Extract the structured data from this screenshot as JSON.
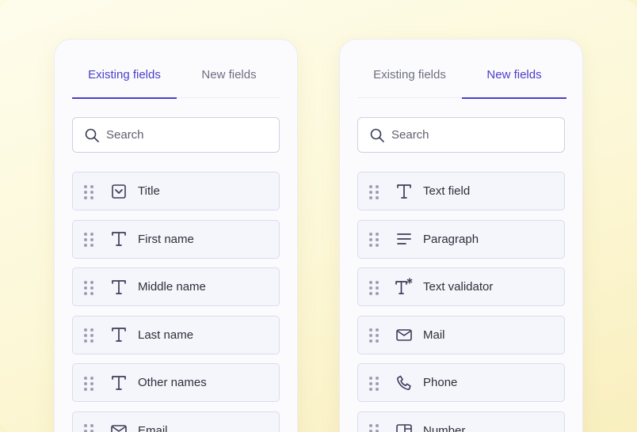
{
  "colors": {
    "accent": "#4a3fc8",
    "icon": "#3c3c58",
    "grip": "#9d9db0"
  },
  "left_panel": {
    "tabs": [
      {
        "label": "Existing fields",
        "active": true
      },
      {
        "label": "New fields",
        "active": false
      }
    ],
    "search": {
      "placeholder": "Search",
      "icon": "search-icon"
    },
    "fields": [
      {
        "label": "Title",
        "icon": "dropdown-icon"
      },
      {
        "label": "First name",
        "icon": "text-icon"
      },
      {
        "label": "Middle name",
        "icon": "text-icon"
      },
      {
        "label": "Last name",
        "icon": "text-icon"
      },
      {
        "label": "Other names",
        "icon": "text-icon"
      },
      {
        "label": "Email",
        "icon": "mail-icon"
      }
    ]
  },
  "right_panel": {
    "tabs": [
      {
        "label": "Existing fields",
        "active": false
      },
      {
        "label": "New fields",
        "active": true
      }
    ],
    "search": {
      "placeholder": "Search",
      "icon": "search-icon"
    },
    "fields": [
      {
        "label": "Text field",
        "icon": "text-icon"
      },
      {
        "label": "Paragraph",
        "icon": "paragraph-icon"
      },
      {
        "label": "Text validator",
        "icon": "text-validator-icon"
      },
      {
        "label": "Mail",
        "icon": "mail-icon"
      },
      {
        "label": "Phone",
        "icon": "phone-icon"
      },
      {
        "label": "Number",
        "icon": "number-icon"
      }
    ]
  }
}
